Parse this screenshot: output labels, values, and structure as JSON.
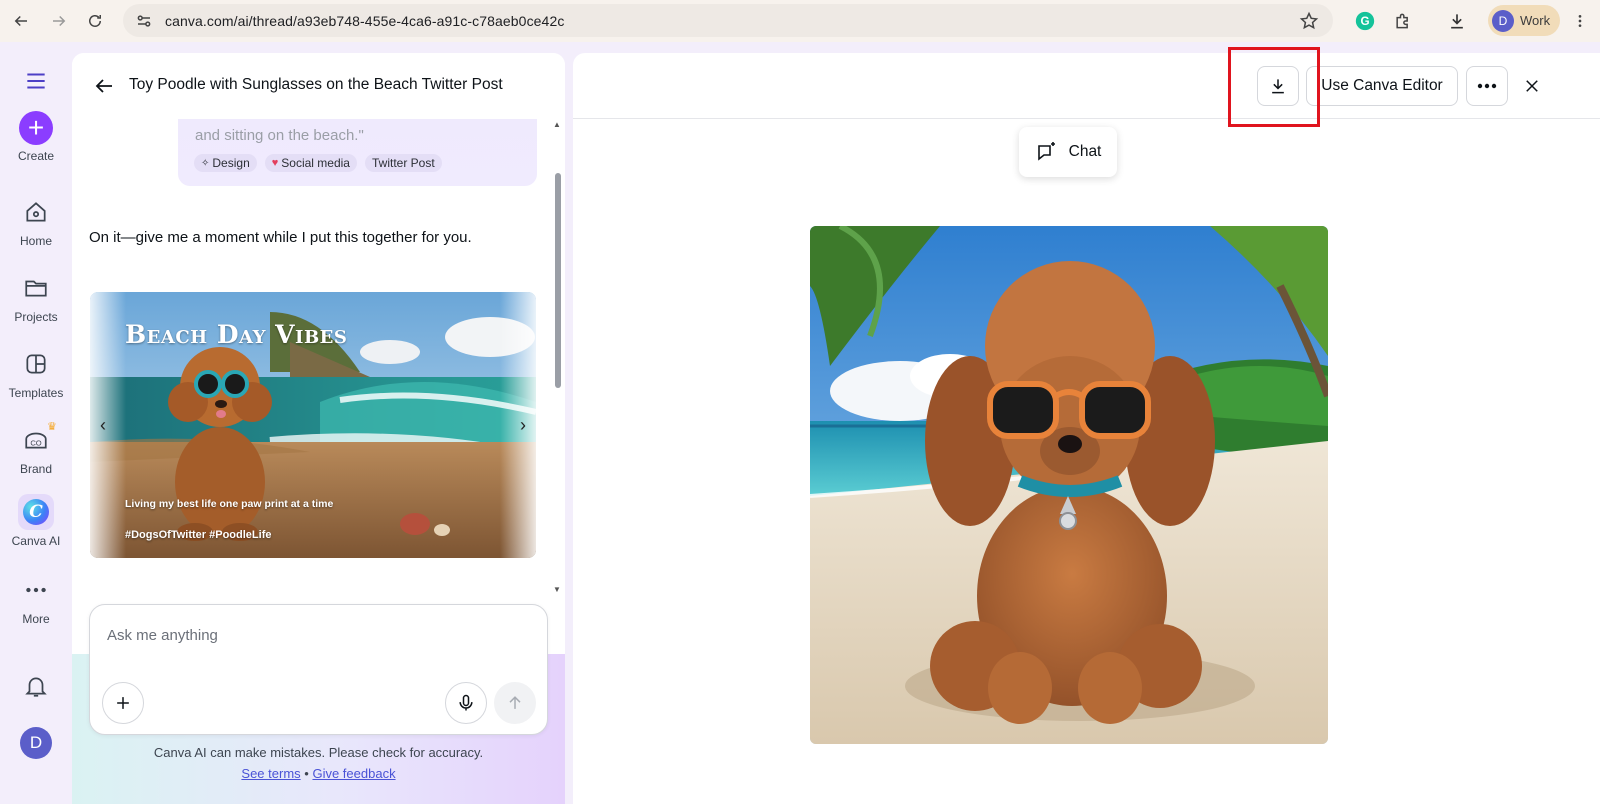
{
  "browser": {
    "url": "canva.com/ai/thread/a93eb748-455e-4ca6-a91c-c78aeb0ce42c",
    "profile_initial": "D",
    "profile_label": "Work"
  },
  "rail": {
    "items": [
      {
        "label": "Create"
      },
      {
        "label": "Home"
      },
      {
        "label": "Projects"
      },
      {
        "label": "Templates"
      },
      {
        "label": "Brand"
      },
      {
        "label": "Canva AI"
      },
      {
        "label": "More"
      }
    ],
    "user_initial": "D"
  },
  "chat": {
    "title": "Toy Poodle with Sunglasses on the Beach Twitter Post",
    "prompt_tail": "and sitting on the beach.\"",
    "tags": [
      "Design",
      "Social media",
      "Twitter Post"
    ],
    "reply": "On it—give me a moment while I put this together for you.",
    "card": {
      "title": "Beach Day Vibes",
      "subtitle": "Living my best life one paw print at a time",
      "hashtags": "#DogsOfTwitter #PoodleLife"
    },
    "composer_placeholder": "Ask me anything",
    "disclaimer": "Canva AI can make mistakes. Please check for accuracy.",
    "link_terms": "See terms",
    "link_separator": "•",
    "link_feedback": "Give feedback"
  },
  "preview": {
    "editor_button": "Use Canva Editor",
    "chat_button": "Chat"
  }
}
